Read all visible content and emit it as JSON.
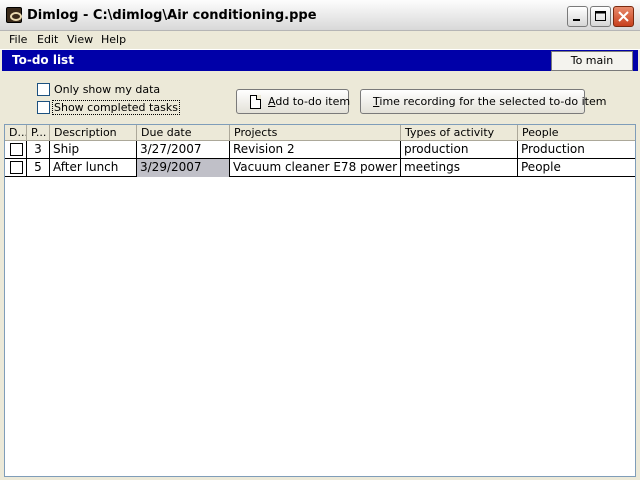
{
  "window": {
    "title": "Dimlog - C:\\dimlog\\Air conditioning.ppe"
  },
  "menu": {
    "items": [
      "File",
      "Edit",
      "View",
      "Help"
    ]
  },
  "header": {
    "title": "To-do list",
    "to_main_label": "To main",
    "band_color": "#0000a8"
  },
  "options": {
    "only_my_data": {
      "label": "Only show my data",
      "checked": false
    },
    "show_completed": {
      "label": "Show completed tasks",
      "checked": false
    }
  },
  "buttons": {
    "add_todo": {
      "prefix": "",
      "accel": "A",
      "rest": "dd to-do item"
    },
    "time_recording": {
      "accel": "T",
      "rest": "ime recording for the selected to-do item"
    }
  },
  "table": {
    "columns": [
      "D...",
      "P...",
      "Description",
      "Due date",
      "Projects",
      "Types of activity",
      "People"
    ],
    "rows": [
      {
        "done": false,
        "priority": "3",
        "description": "Ship",
        "due_date": "3/27/2007",
        "project": "Revision 2",
        "activity": "production",
        "people": "Production"
      },
      {
        "done": false,
        "priority": "5",
        "description": "After lunch",
        "due_date": "3/29/2007",
        "project": "Vacuum cleaner E78 power",
        "activity": "meetings",
        "people": "People"
      }
    ]
  }
}
